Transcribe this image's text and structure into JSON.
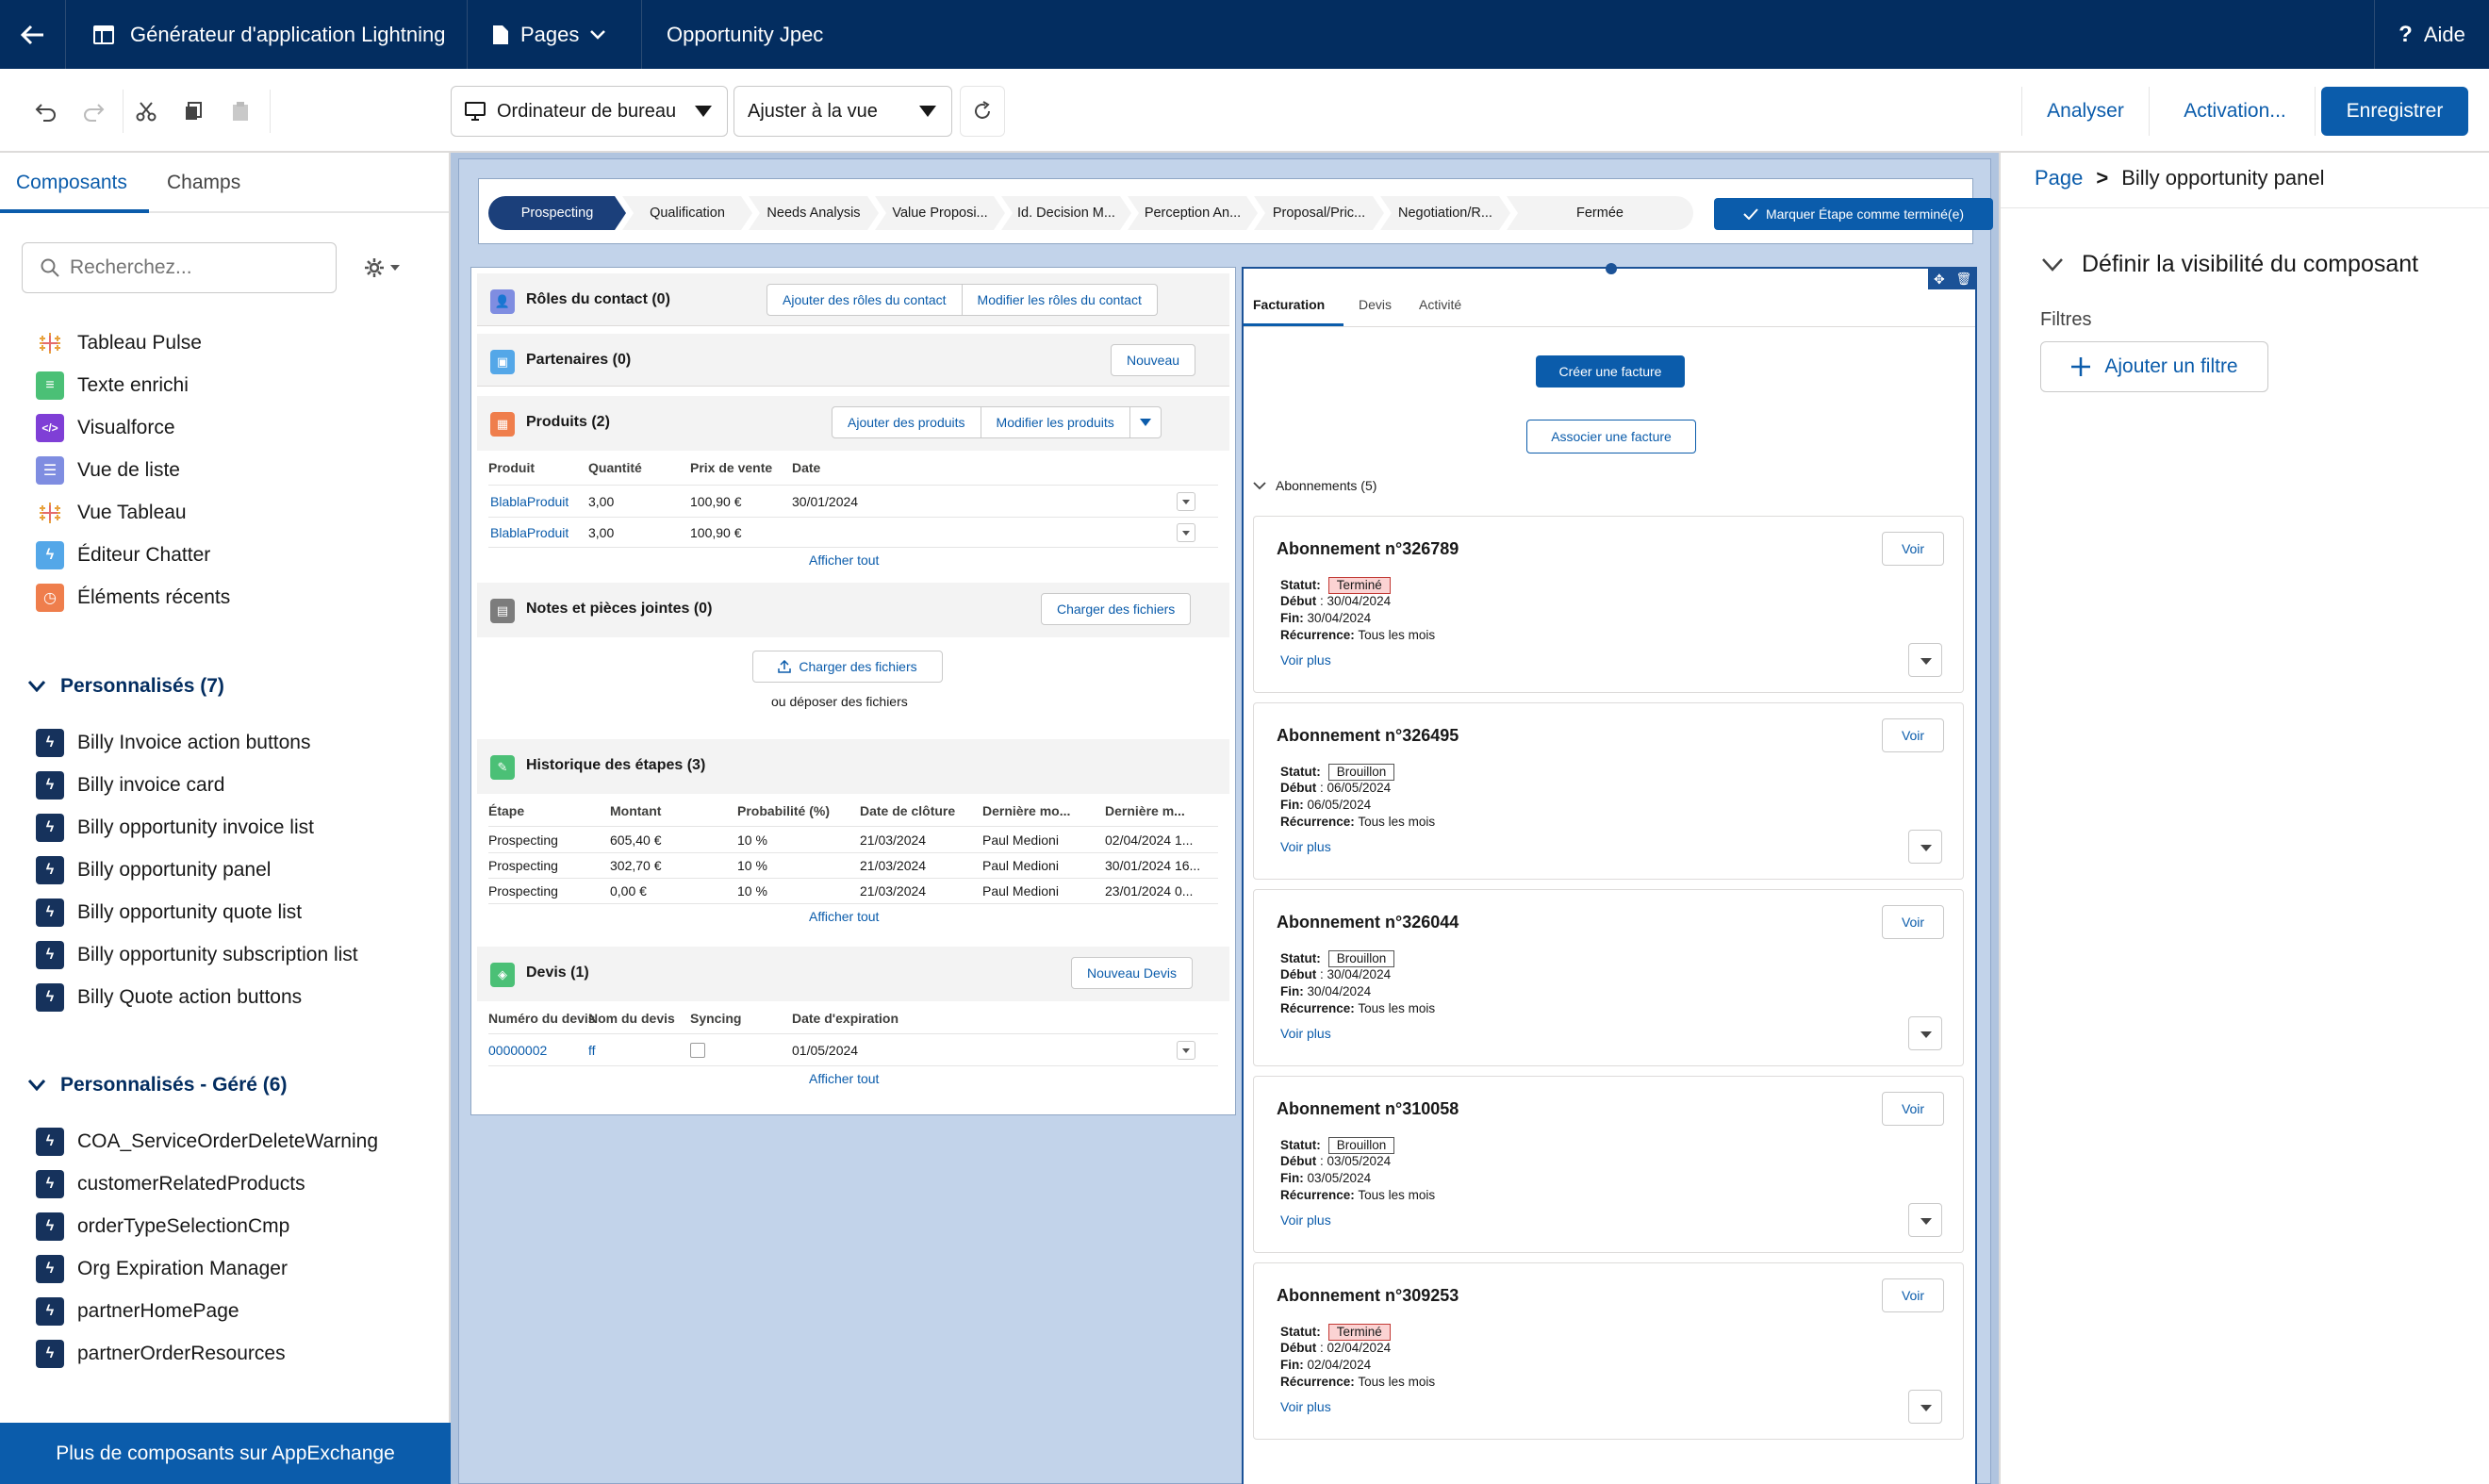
{
  "topbar": {
    "app_title": "Générateur d'application Lightning",
    "pages_label": "Pages",
    "page_name": "Opportunity Jpec",
    "help_label": "Aide"
  },
  "toolbar": {
    "device_label": "Ordinateur de bureau",
    "zoom_label": "Ajuster à la vue",
    "analyze_label": "Analyser",
    "activation_label": "Activation...",
    "save_label": "Enregistrer"
  },
  "left_panel": {
    "tabs": [
      "Composants",
      "Champs"
    ],
    "search_placeholder": "Recherchez...",
    "standard_items": [
      {
        "label": "Tableau Pulse",
        "icon": "tableau-icon",
        "color": "#e8a33d"
      },
      {
        "label": "Texte enrichi",
        "icon": "rich-text-icon",
        "color": "#4bc076"
      },
      {
        "label": "Visualforce",
        "icon": "visualforce-icon",
        "color": "#7f3fd6"
      },
      {
        "label": "Vue de liste",
        "icon": "list-view-icon",
        "color": "#7f8de1"
      },
      {
        "label": "Vue Tableau",
        "icon": "tableau-icon",
        "color": "#e8a33d"
      },
      {
        "label": "Éditeur Chatter",
        "icon": "chatter-icon",
        "color": "#54a7e8"
      },
      {
        "label": "Éléments récents",
        "icon": "recent-icon",
        "color": "#ef7e4c"
      }
    ],
    "custom_section": "Personnalisés (7)",
    "custom_items": [
      "Billy Invoice action buttons",
      "Billy invoice card",
      "Billy opportunity invoice list",
      "Billy opportunity panel",
      "Billy opportunity quote list",
      "Billy opportunity subscription list",
      "Billy Quote action buttons"
    ],
    "managed_section": "Personnalisés - Géré (6)",
    "managed_items": [
      "COA_ServiceOrderDeleteWarning",
      "customerRelatedProducts",
      "orderTypeSelectionCmp",
      "Org Expiration Manager",
      "partnerHomePage",
      "partnerOrderResources"
    ],
    "appexchange_label": "Plus de composants sur AppExchange"
  },
  "path": {
    "stages": [
      "Prospecting",
      "Qualification",
      "Needs Analysis",
      "Value Proposi...",
      "Id. Decision M...",
      "Perception An...",
      "Proposal/Pric...",
      "Negotiation/R...",
      "Fermée"
    ],
    "mark_button": "Marquer Étape comme terminé(e)"
  },
  "cards": {
    "roles": {
      "title": "Rôles du contact (0)",
      "btn_add": "Ajouter des rôles du contact",
      "btn_edit": "Modifier les rôles du contact"
    },
    "partners": {
      "title": "Partenaires (0)",
      "btn_new": "Nouveau"
    },
    "products": {
      "title": "Produits (2)",
      "btn_add": "Ajouter des produits",
      "btn_edit": "Modifier les produits",
      "headers": [
        "Produit",
        "Quantité",
        "Prix de vente",
        "Date"
      ],
      "rows": [
        [
          "BlablaProduit",
          "3,00",
          "100,90 €",
          "30/01/2024"
        ],
        [
          "BlablaProduit",
          "3,00",
          "100,90 €",
          ""
        ]
      ],
      "view_all": "Afficher tout"
    },
    "notes": {
      "title": "Notes et pièces jointes (0)",
      "btn_upload": "Charger des fichiers",
      "upload_label": "Charger des fichiers",
      "drop_label": "ou déposer des fichiers"
    },
    "history": {
      "title": "Historique des étapes (3)",
      "headers": [
        "Étape",
        "Montant",
        "Probabilité (%)",
        "Date de clôture",
        "Dernière mo...",
        "Dernière m..."
      ],
      "rows": [
        [
          "Prospecting",
          "605,40 €",
          "10 %",
          "21/03/2024",
          "Paul Medioni",
          "02/04/2024 1..."
        ],
        [
          "Prospecting",
          "302,70 €",
          "10 %",
          "21/03/2024",
          "Paul Medioni",
          "30/01/2024 16..."
        ],
        [
          "Prospecting",
          "0,00 €",
          "10 %",
          "21/03/2024",
          "Paul Medioni",
          "23/01/2024 0..."
        ]
      ],
      "view_all": "Afficher tout"
    },
    "quotes": {
      "title": "Devis (1)",
      "btn_new": "Nouveau Devis",
      "headers": [
        "Numéro du devis",
        "Nom du devis",
        "Syncing",
        "Date d'expiration"
      ],
      "rows": [
        [
          "00000002",
          "ff",
          "",
          "01/05/2024"
        ]
      ],
      "view_all": "Afficher tout"
    }
  },
  "billing_panel": {
    "tabs": [
      "Facturation",
      "Devis",
      "Activité"
    ],
    "create_invoice": "Créer une facture",
    "associate_invoice": "Associer une facture",
    "subscriptions_header": "Abonnements (5)",
    "labels": {
      "status": "Statut:",
      "start": "Début",
      "end": "Fin:",
      "recurrence": "Récurrence:",
      "view": "Voir",
      "more": "Voir plus"
    },
    "subscriptions": [
      {
        "title": "Abonnement n°326789",
        "status": "Terminé",
        "start": "30/04/2024",
        "end": "30/04/2024",
        "recurrence": "Tous les mois"
      },
      {
        "title": "Abonnement n°326495",
        "status": "Brouillon",
        "start": "06/05/2024",
        "end": "06/05/2024",
        "recurrence": "Tous les mois"
      },
      {
        "title": "Abonnement n°326044",
        "status": "Brouillon",
        "start": "30/04/2024",
        "end": "30/04/2024",
        "recurrence": "Tous les mois"
      },
      {
        "title": "Abonnement n°310058",
        "status": "Brouillon",
        "start": "03/05/2024",
        "end": "03/05/2024",
        "recurrence": "Tous les mois"
      },
      {
        "title": "Abonnement n°309253",
        "status": "Terminé",
        "start": "02/04/2024",
        "end": "02/04/2024",
        "recurrence": "Tous les mois"
      }
    ]
  },
  "right_panel": {
    "breadcrumb_page": "Page",
    "breadcrumb_sep": ">",
    "breadcrumb_current": "Billy opportunity panel",
    "section_title": "Définir la visibilité du composant",
    "filters_label": "Filtres",
    "add_filter": "Ajouter un filtre"
  }
}
